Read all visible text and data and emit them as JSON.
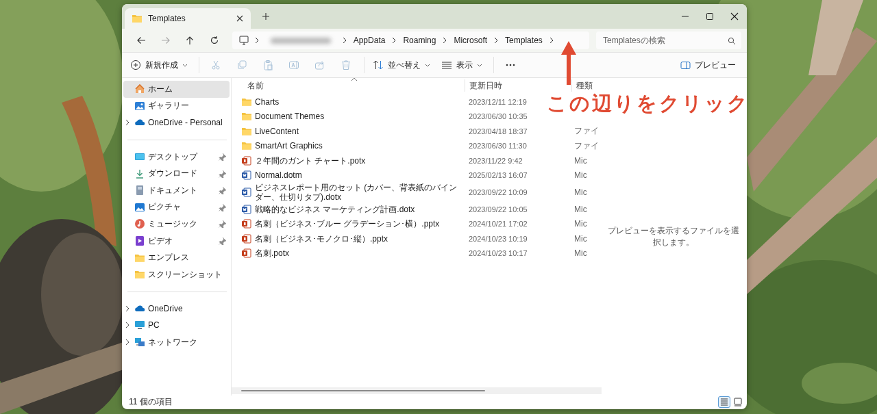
{
  "tabs": [
    {
      "label": "Templates",
      "selected": true
    }
  ],
  "address": {
    "segments": [
      "AppData",
      "Roaming",
      "Microsoft",
      "Templates"
    ]
  },
  "search": {
    "placeholder": "Templatesの検索"
  },
  "toolbar": {
    "items": [
      {
        "kind": "new",
        "label": "新規作成",
        "dropdown": true,
        "disabled": false
      },
      {
        "kind": "cut",
        "dropdown": false,
        "disabled": true
      },
      {
        "kind": "copy",
        "dropdown": false,
        "disabled": true
      },
      {
        "kind": "paste",
        "dropdown": false,
        "disabled": true
      },
      {
        "kind": "rename",
        "dropdown": false,
        "disabled": true
      },
      {
        "kind": "share",
        "dropdown": false,
        "disabled": true
      },
      {
        "kind": "delete",
        "dropdown": false,
        "disabled": true
      },
      {
        "kind": "sort",
        "label": "並べ替え",
        "dropdown": true,
        "disabled": false
      },
      {
        "kind": "view",
        "label": "表示",
        "dropdown": true,
        "disabled": false
      },
      {
        "kind": "more",
        "dropdown": false,
        "disabled": false
      }
    ],
    "preview_toggle": {
      "label": "プレビュー"
    }
  },
  "sidebar": {
    "sections": [
      {
        "items": [
          {
            "kind": "home",
            "label": "ホーム",
            "expandable": false,
            "pinned": false,
            "selected": true
          },
          {
            "kind": "gallery",
            "label": "ギャラリー",
            "expandable": false,
            "pinned": false,
            "selected": false
          },
          {
            "kind": "cloud",
            "label": "OneDrive - Personal",
            "expandable": true,
            "pinned": false,
            "selected": false
          }
        ]
      },
      {
        "items": [
          {
            "kind": "desktop",
            "label": "デスクトップ",
            "expandable": false,
            "pinned": true,
            "selected": false
          },
          {
            "kind": "download",
            "label": "ダウンロード",
            "expandable": false,
            "pinned": true,
            "selected": false
          },
          {
            "kind": "documents",
            "label": "ドキュメント",
            "expandable": false,
            "pinned": true,
            "selected": false
          },
          {
            "kind": "pictures",
            "label": "ピクチャ",
            "expandable": false,
            "pinned": true,
            "selected": false
          },
          {
            "kind": "music",
            "label": "ミュージック",
            "expandable": false,
            "pinned": true,
            "selected": false
          },
          {
            "kind": "videos",
            "label": "ビデオ",
            "expandable": false,
            "pinned": true,
            "selected": false
          },
          {
            "kind": "folder",
            "label": "エンプレス",
            "expandable": false,
            "pinned": false,
            "selected": false
          },
          {
            "kind": "folder",
            "label": "スクリーンショット",
            "expandable": false,
            "pinned": false,
            "selected": false
          }
        ]
      },
      {
        "items": [
          {
            "kind": "cloud",
            "label": "OneDrive",
            "expandable": true,
            "pinned": false,
            "selected": false
          },
          {
            "kind": "pc",
            "label": "PC",
            "expandable": true,
            "pinned": false,
            "selected": false
          },
          {
            "kind": "network",
            "label": "ネットワーク",
            "expandable": true,
            "pinned": false,
            "selected": false
          }
        ]
      }
    ]
  },
  "file_list": {
    "columns": [
      "名前",
      "更新日時",
      "種類"
    ],
    "rows": [
      {
        "kind": "folder",
        "name": "Charts",
        "modified": "2023/12/11 12:19"
      },
      {
        "kind": "folder",
        "name": "Document Themes",
        "modified": "2023/06/30 10:35"
      },
      {
        "kind": "folder",
        "name": "LiveContent",
        "modified": "2023/04/18 18:37",
        "type": "ファイ"
      },
      {
        "kind": "folder",
        "name": "SmartArt Graphics",
        "modified": "2023/06/30 11:30",
        "type": "ファイ"
      },
      {
        "kind": "ppt",
        "name": "２年間のガント チャート.potx",
        "modified": "2023/11/22 9:42",
        "type": "Mic"
      },
      {
        "kind": "word",
        "name": "Normal.dotm",
        "modified": "2025/02/13 16:07",
        "type": "Mic"
      },
      {
        "kind": "word",
        "name": "ビジネスレポート用のセット (カバー、背表紙のバインダー、仕切りタブ).dotx",
        "modified": "2023/09/22 10:09",
        "type": "Mic"
      },
      {
        "kind": "word",
        "name": "戦略的なビジネス マーケティング計画.dotx",
        "modified": "2023/09/22 10:05",
        "type": "Mic"
      },
      {
        "kind": "ppt",
        "name": "名刺（ビジネス･ブルー グラデーション･横）.pptx",
        "modified": "2024/10/21 17:02",
        "type": "Mic"
      },
      {
        "kind": "ppt",
        "name": "名刺（ビジネス･モノクロ･縦）.pptx",
        "modified": "2024/10/23 10:19",
        "type": "Mic"
      },
      {
        "kind": "ppt",
        "name": "名刺.potx",
        "modified": "2024/10/23 10:17",
        "type": "Mic"
      }
    ]
  },
  "preview": {
    "message": "プレビューを表示するファイルを選択します。"
  },
  "status_bar": {
    "item_count": "11 個の項目",
    "views": [
      {
        "kind": "details",
        "selected": true
      },
      {
        "kind": "tiles",
        "selected": false
      }
    ]
  },
  "annotation": {
    "text": "この辺りをクリック"
  }
}
